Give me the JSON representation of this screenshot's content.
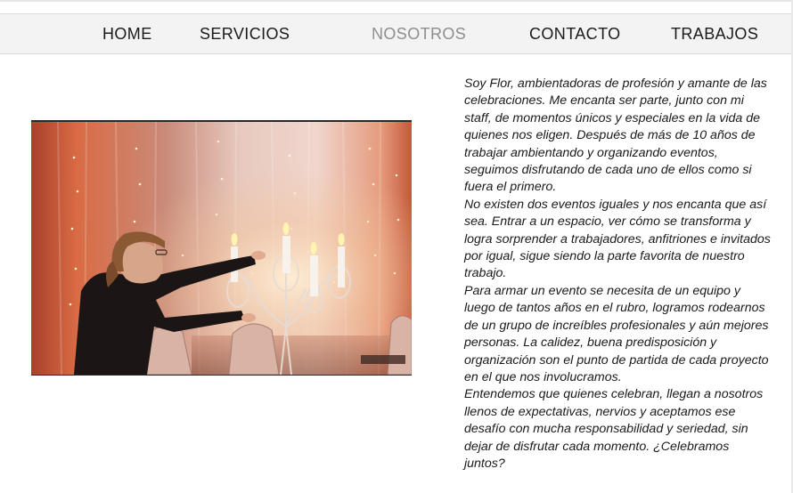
{
  "nav": {
    "items": [
      {
        "label": "HOME"
      },
      {
        "label": "SERVICIOS"
      },
      {
        "label": "NOSOTROS",
        "active": true
      },
      {
        "label": "CONTACTO"
      },
      {
        "label": "TRABAJOS"
      }
    ]
  },
  "about": {
    "paragraphs": [
      "Soy Flor, ambientadoras de profesión y amante de las celebraciones. Me encanta ser parte, junto con mi staff, de momentos únicos y especiales en la vida de quienes nos eligen. Después de más de 10 años de trabajar ambientando y organizando eventos, seguimos disfrutando de cada uno de ellos como si fuera el primero.",
      "No existen dos eventos iguales y nos encanta que así sea. Entrar a un espacio, ver cómo se transforma y logra sorprender a trabajadores, anfitriones e invitados por igual, sigue siendo la parte favorita de nuestro trabajo.",
      "Para armar un evento se necesita de un equipo y luego de tantos años en el rubro, logramos rodearnos de un grupo de increíbles profesionales y aún mejores personas. La calidez, buena predisposición y organización son el punto de partida de cada proyecto en el que nos involucramos.",
      "Entendemos que quienes celebran, llegan a nosotros llenos de expectativas, nervios y aceptamos ese desafío con mucha responsabilidad y seriedad, sin dejar de disfrutar cada momento. ¿Celebramos juntos?"
    ]
  },
  "colors": {
    "nav_bg": "#f4f3f4",
    "nav_text": "#1b1b1b",
    "nav_active": "#8e8e8e",
    "body_text": "#1a1a1a"
  }
}
